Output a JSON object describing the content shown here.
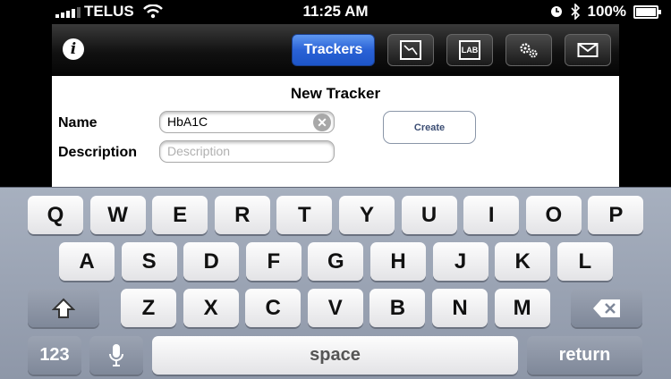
{
  "status_bar": {
    "carrier": "TELUS",
    "time": "11:25 AM",
    "battery_percent": "100%",
    "battery_level": 1.0,
    "icons": [
      "signal-bars-icon",
      "wifi-icon",
      "clock-icon",
      "bluetooth-icon",
      "battery-icon"
    ]
  },
  "toolbar": {
    "info_label": "i",
    "trackers_label": "Trackers",
    "icons": [
      "info-icon",
      "chart-icon",
      "lab-icon",
      "gears-icon",
      "mail-icon"
    ],
    "lab_label": "LAB",
    "active_color": "#2a62d6"
  },
  "form": {
    "title": "New Tracker",
    "name_label": "Name",
    "name_value": "HbA1C",
    "description_label": "Description",
    "description_placeholder": "Description",
    "create_label": "Create"
  },
  "keyboard": {
    "row1": [
      "Q",
      "W",
      "E",
      "R",
      "T",
      "Y",
      "U",
      "I",
      "O",
      "P"
    ],
    "row2": [
      "A",
      "S",
      "D",
      "F",
      "G",
      "H",
      "J",
      "K",
      "L"
    ],
    "row3": [
      "Z",
      "X",
      "C",
      "V",
      "B",
      "N",
      "M"
    ],
    "numbers_label": "123",
    "space_label": "space",
    "return_label": "return"
  }
}
